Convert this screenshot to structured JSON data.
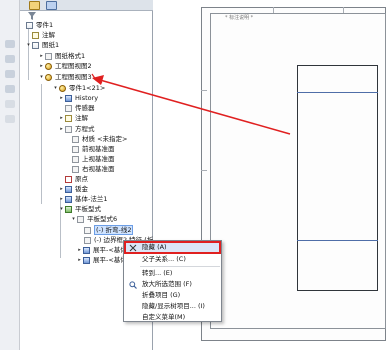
{
  "colors": {
    "annotation_red": "#e02020",
    "selection_blue": "#cfe3ff",
    "menu_highlight": "#dbe6f7"
  },
  "panel": {
    "tabs": [
      "feature-manager-icon",
      "property-manager-icon"
    ],
    "filter_icon": "filter-icon"
  },
  "tree": {
    "root": "零件1",
    "annotations": "注解",
    "sheet": "图纸1",
    "sheet_format": "图纸格式1",
    "drawing_view2": "工程图视图2",
    "drawing_view3": "工程图视图3",
    "part_ref": "零件1<21>",
    "history": "History",
    "sensors": "传感器",
    "part_annotations": "注解",
    "equations": "方程式",
    "material": "材质 <未指定>",
    "front_plane": "前视基准面",
    "top_plane": "上视基准面",
    "right_plane": "右视基准面",
    "origin": "原点",
    "sheet_metal": "钣金",
    "base_flange": "基体-法兰1",
    "flat_pattern": "平板型式",
    "flat_pattern6": "平板型式6",
    "bend_line": "(-) 折弯-线2",
    "boundary_box": "(-) 边界框2 特征 (折弯-线2)",
    "flat1": "展平-<基体",
    "flat2": "展平-<基体"
  },
  "context_menu": {
    "items": [
      {
        "label": "隐藏 (A)",
        "icon": "hide-icon"
      },
      {
        "label": "父子关系... (C)",
        "icon": ""
      },
      {
        "label": "转到... (E)",
        "icon": ""
      },
      {
        "label": "放大所选范围 (F)",
        "icon": "zoom-icon"
      },
      {
        "label": "折叠项目 (G)",
        "icon": ""
      },
      {
        "label": "隐藏/显示树项目... (I)",
        "icon": ""
      },
      {
        "label": "自定义菜单(M)",
        "icon": ""
      }
    ]
  },
  "sheet": {
    "title_mark": "* 标注说明 *"
  }
}
